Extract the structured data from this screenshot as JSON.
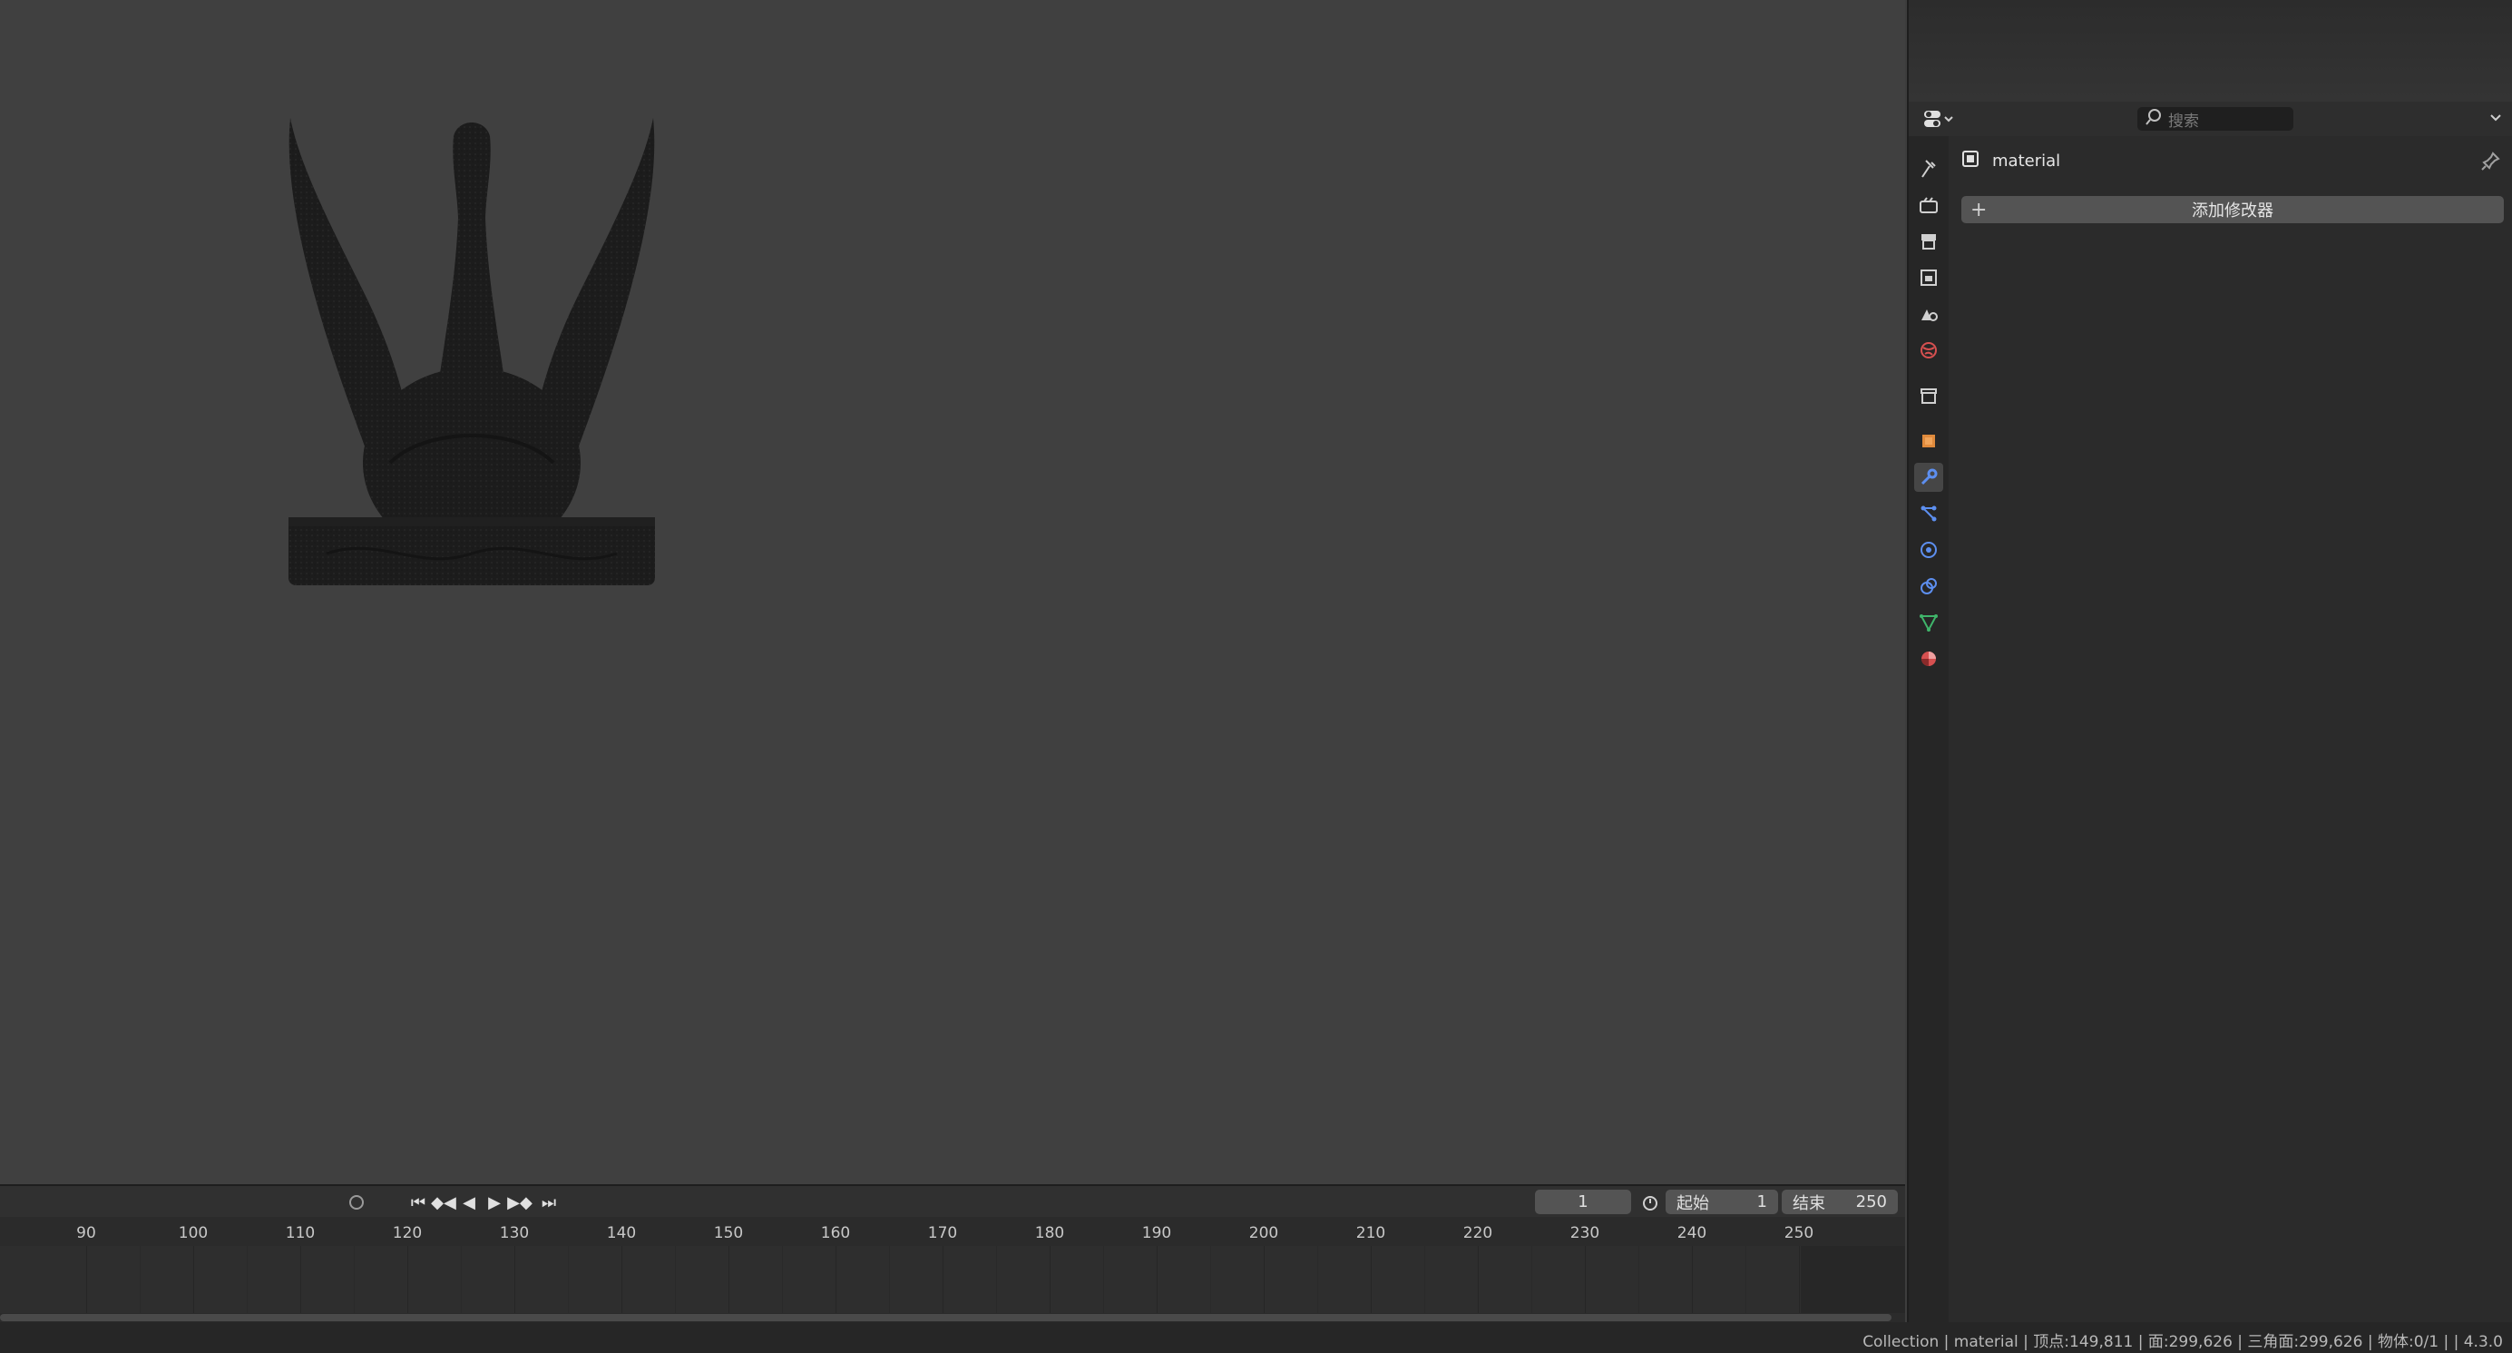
{
  "viewport": {
    "object_description": "swan-statue"
  },
  "timeline": {
    "current_frame": "1",
    "start_label": "起始",
    "start_value": "1",
    "end_label": "结束",
    "end_value": "250",
    "ruler_ticks": [
      "90",
      "100",
      "110",
      "120",
      "130",
      "140",
      "150",
      "160",
      "170",
      "180",
      "190",
      "200",
      "210",
      "220",
      "230",
      "240",
      "250"
    ]
  },
  "properties": {
    "search_placeholder": "搜索",
    "object_name": "material",
    "add_modifier_label": "添加修改器"
  },
  "statusbar": {
    "text": "Collection | material | 顶点:149,811 | 面:299,626 | 三角面:299,626 | 物体:0/1 |  | 4.3.0"
  },
  "colors": {
    "accent_blue": "#5d8ff0",
    "object_orange": "#e08a3c",
    "data_green": "#3fb46a",
    "material_red": "#d65050"
  }
}
